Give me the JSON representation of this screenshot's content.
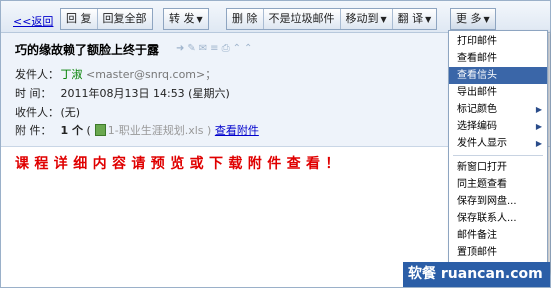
{
  "toolbar": {
    "back": "<<返回",
    "reply": "回 复",
    "reply_all": "回复全部",
    "forward": "转 发",
    "delete": "删 除",
    "not_spam": "不是垃圾邮件",
    "move_to": "移动到",
    "translate": "翻 译",
    "more": "更 多"
  },
  "message": {
    "subject": "巧的缘故赖了额脸上终于露",
    "sender_label": "发件人：",
    "sender_name": "丁淑",
    "sender_email": "<master@snrq.com>；",
    "time_label": "时   间：",
    "time_value": "2011年08月13日  14:53 (星期六)",
    "to_label": "收件人：",
    "to_value": "(无)",
    "attach_label": "附   件：",
    "attach_count": "1 个",
    "attach_name": "1-职业生涯规划.xls )",
    "attach_link": "查看附件",
    "body": "课程详细内容请预览或下载附件查看！"
  },
  "menu": {
    "items": [
      "打印邮件",
      "查看邮件",
      "查看信头",
      "导出邮件",
      "标记颜色",
      "选择编码",
      "发件人显示",
      "新窗口打开",
      "同主题查看",
      "保存到网盘...",
      "保存联系人...",
      "邮件备注",
      "置顶邮件"
    ]
  },
  "watermark": "软餐 ruancan.com"
}
